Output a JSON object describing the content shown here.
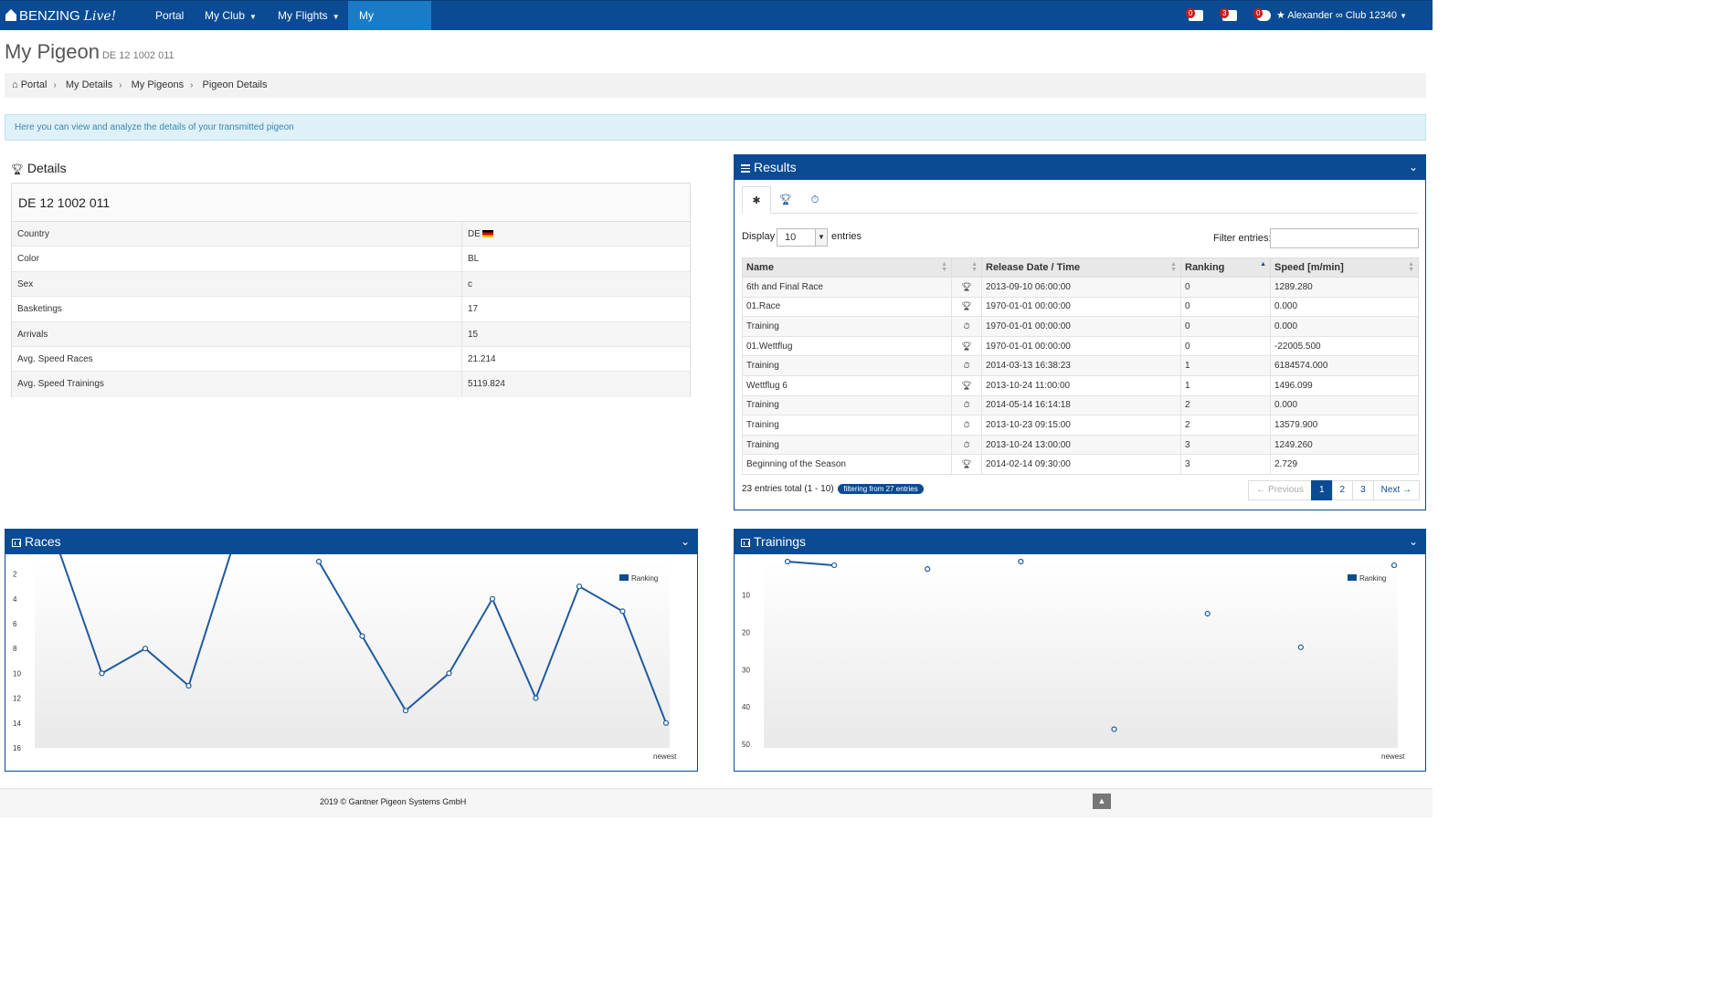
{
  "nav": {
    "brand": "BENZING",
    "brand_suffix": "Live!",
    "items": [
      {
        "label": "Portal"
      },
      {
        "label": "My Club"
      },
      {
        "label": "My Flights"
      },
      {
        "label": "My Details"
      }
    ],
    "badges": [
      "0",
      "3",
      "0"
    ],
    "user": "★ Alexander ∞ Club 12340"
  },
  "header": {
    "title": "My Pigeon",
    "subtitle": "DE 12 1002 011"
  },
  "breadcrumb": [
    "Portal",
    "My Details",
    "My Pigeons",
    "Pigeon Details"
  ],
  "info": "Here you can view and analyze the details of your transmitted pigeon",
  "details": {
    "title": "Details",
    "ring": "DE 12 1002 011",
    "rows": [
      {
        "k": "Country",
        "v": "DE"
      },
      {
        "k": "Color",
        "v": "BL"
      },
      {
        "k": "Sex",
        "v": "c"
      },
      {
        "k": "Basketings",
        "v": "17"
      },
      {
        "k": "Arrivals",
        "v": "15"
      },
      {
        "k": "Avg. Speed Races",
        "v": "21.214"
      },
      {
        "k": "Avg. Speed Trainings",
        "v": "5119.824"
      }
    ]
  },
  "results": {
    "title": "Results",
    "display_label": "Display",
    "display_value": "10",
    "entries_label": "entries",
    "filter_label": "Filter entries:",
    "columns": [
      "Name",
      "",
      "Release Date / Time",
      "Ranking",
      "Speed [m/min]"
    ],
    "rows": [
      {
        "name": "6th and Final Race",
        "type": "race",
        "date": "2013-09-10 06:00:00",
        "rank": "0",
        "speed": "1289.280"
      },
      {
        "name": "01.Race",
        "type": "race",
        "date": "1970-01-01 00:00:00",
        "rank": "0",
        "speed": "0.000"
      },
      {
        "name": "Training",
        "type": "training",
        "date": "1970-01-01 00:00:00",
        "rank": "0",
        "speed": "0.000"
      },
      {
        "name": "01.Wettflug",
        "type": "race",
        "date": "1970-01-01 00:00:00",
        "rank": "0",
        "speed": "-22005.500"
      },
      {
        "name": "Training",
        "type": "training",
        "date": "2014-03-13 16:38:23",
        "rank": "1",
        "speed": "6184574.000"
      },
      {
        "name": "Wettflug 6",
        "type": "race",
        "date": "2013-10-24 11:00:00",
        "rank": "1",
        "speed": "1496.099"
      },
      {
        "name": "Training",
        "type": "training",
        "date": "2014-05-14 16:14:18",
        "rank": "2",
        "speed": "0.000"
      },
      {
        "name": "Training",
        "type": "training",
        "date": "2013-10-23 09:15:00",
        "rank": "2",
        "speed": "13579.900"
      },
      {
        "name": "Training",
        "type": "training",
        "date": "2013-10-24 13:00:00",
        "rank": "3",
        "speed": "1249.260"
      },
      {
        "name": "Beginning of the Season",
        "type": "race",
        "date": "2014-02-14 09:30:00",
        "rank": "3",
        "speed": "2.729"
      }
    ],
    "total": "23 entries total (1 - 10)",
    "filter_badge": "filtering from 27 entries",
    "pager": {
      "prev": "← Previous",
      "pages": [
        "1",
        "2",
        "3"
      ],
      "next": "Next →"
    }
  },
  "chart_data": [
    {
      "type": "line",
      "title": "Races",
      "legend": "Ranking",
      "xlabel": "newest",
      "yticks": [
        2,
        4,
        6,
        8,
        10,
        12,
        14,
        16
      ],
      "ylim": [
        1,
        16
      ],
      "reversed": true,
      "values": [
        0,
        10,
        8,
        11,
        0,
        null,
        1,
        7,
        13,
        10,
        4,
        12,
        3,
        5,
        14
      ]
    },
    {
      "type": "line",
      "title": "Trainings",
      "legend": "Ranking",
      "xlabel": "newest",
      "yticks": [
        10,
        20,
        30,
        40,
        50
      ],
      "ylim": [
        1,
        51
      ],
      "reversed": true,
      "values": [
        1,
        2,
        null,
        3,
        null,
        1,
        null,
        46,
        null,
        15,
        null,
        24,
        null,
        2
      ]
    }
  ],
  "footer": {
    "copy": "2019 © Gantner Pigeon Systems GmbH",
    "up": "▲"
  }
}
